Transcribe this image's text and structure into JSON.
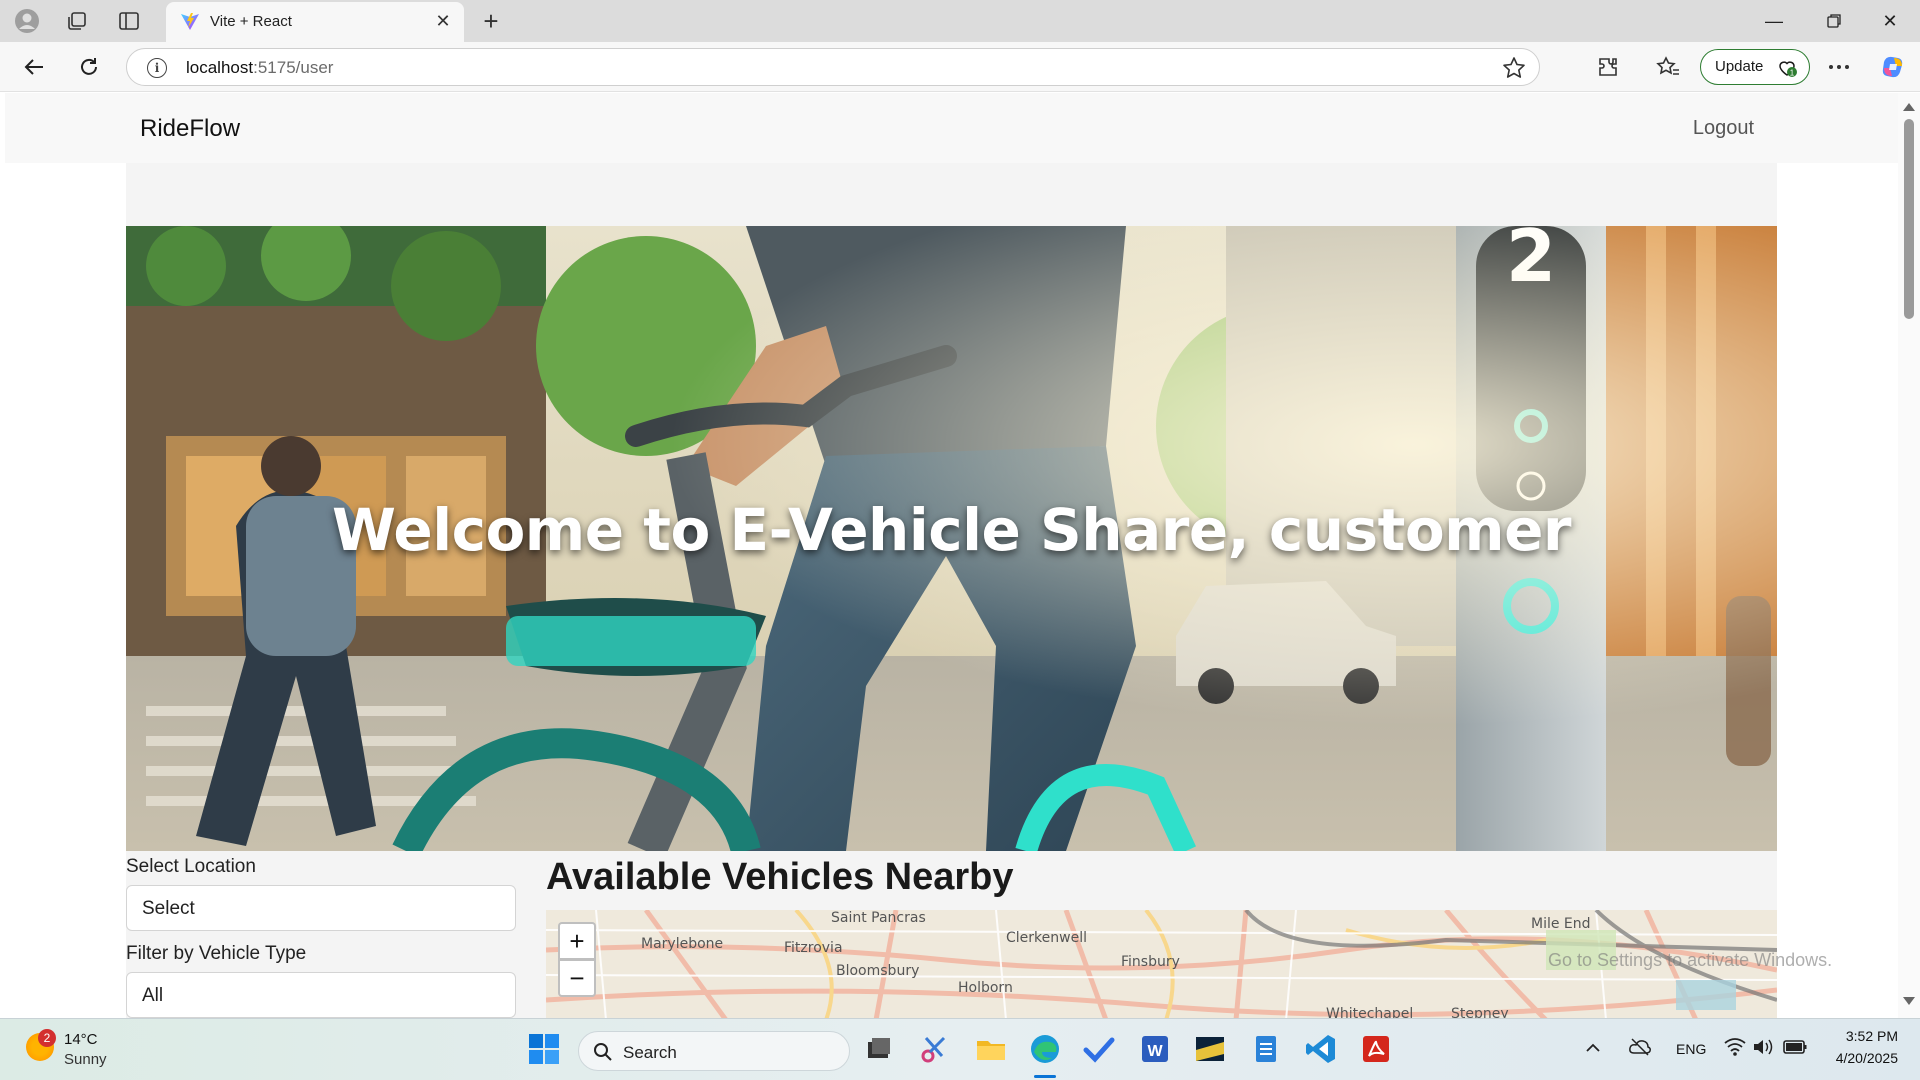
{
  "browser": {
    "tab_title": "Vite + React",
    "url_host": "localhost",
    "url_path": ":5175/user",
    "update_label": "Update"
  },
  "app": {
    "brand": "RideFlow",
    "logout": "Logout",
    "hero_title": "Welcome to E-Vehicle Share, customer"
  },
  "filters": {
    "location_label": "Select Location",
    "location_value": "Select",
    "vehicle_type_label": "Filter by Vehicle Type",
    "vehicle_type_value": "All"
  },
  "vehicles": {
    "title": "Available Vehicles Nearby",
    "zoom_in": "+",
    "zoom_out": "−",
    "map_labels": [
      "Saint Pancras",
      "Marylebone",
      "Fitzrovia",
      "Bloomsbury",
      "Clerkenwell",
      "Finsbury",
      "Holborn",
      "Mile End",
      "Whitechapel",
      "Stepney"
    ]
  },
  "system": {
    "watermark": "Go to Settings to activate Windows.",
    "weather_temp": "14°C",
    "weather_cond": "Sunny",
    "weather_badge": "2",
    "search_placeholder": "Search",
    "language": "ENG",
    "time": "3:52 PM",
    "date": "4/20/2025"
  }
}
